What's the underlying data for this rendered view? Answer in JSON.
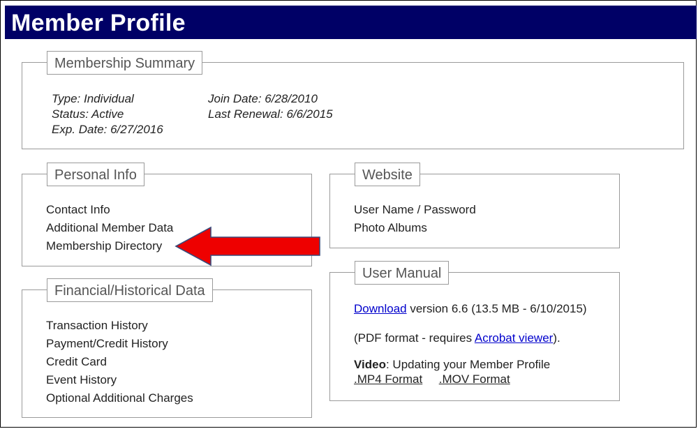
{
  "header": {
    "title": "Member Profile"
  },
  "membership_summary": {
    "legend": "Membership Summary",
    "type": "Type: Individual",
    "status": "Status: Active",
    "exp_date": "Exp. Date: 6/27/2016",
    "join_date": "Join Date: 6/28/2010",
    "last_renewal": "Last Renewal: 6/6/2015"
  },
  "personal_info": {
    "legend": "Personal Info",
    "items": [
      "Contact Info",
      "Additional Member Data",
      "Membership Directory"
    ]
  },
  "financial": {
    "legend": "Financial/Historical Data",
    "items": [
      "Transaction History",
      "Payment/Credit History",
      "Credit Card",
      "Event History",
      "Optional Additional Charges"
    ]
  },
  "website": {
    "legend": "Website",
    "items": [
      "User Name / Password",
      "Photo Albums"
    ]
  },
  "user_manual": {
    "legend": "User Manual",
    "download_link": "Download",
    "download_text": " version 6.6 (13.5 MB - 6/10/2015)",
    "pdf_prefix": "(PDF format - requires ",
    "acrobat_link": "Acrobat viewer",
    "pdf_suffix": ").",
    "video_label": "Video",
    "video_text": ": Updating your Member Profile",
    "mp4_link": ".MP4 Format",
    "mov_link": ".MOV Format"
  },
  "colors": {
    "header_bg": "#000066",
    "arrow": "#ee0000",
    "link": "#0000cc"
  }
}
